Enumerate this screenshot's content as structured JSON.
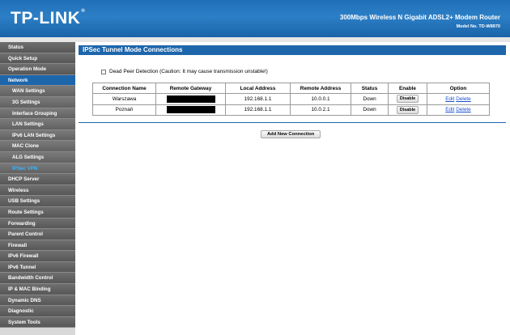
{
  "header": {
    "logo": "TP-LINK",
    "logo_mark": "®",
    "product": "300Mbps Wireless N Gigabit ADSL2+ Modem Router",
    "model": "Model No. TD-W8970"
  },
  "sidebar": {
    "items": [
      {
        "label": "Status",
        "level": 0,
        "state": "normal"
      },
      {
        "label": "Quick Setup",
        "level": 0,
        "state": "normal"
      },
      {
        "label": "Operation Mode",
        "level": 0,
        "state": "normal"
      },
      {
        "label": "Network",
        "level": 0,
        "state": "active"
      },
      {
        "label": "WAN Settings",
        "level": 1,
        "state": "normal"
      },
      {
        "label": "3G Settings",
        "level": 1,
        "state": "normal"
      },
      {
        "label": "Interface Grouping",
        "level": 1,
        "state": "normal"
      },
      {
        "label": "LAN Settings",
        "level": 1,
        "state": "normal"
      },
      {
        "label": "IPv6 LAN Settings",
        "level": 1,
        "state": "normal"
      },
      {
        "label": "MAC Clone",
        "level": 1,
        "state": "normal"
      },
      {
        "label": "ALG Settings",
        "level": 1,
        "state": "normal"
      },
      {
        "label": "IPSec VPN",
        "level": 1,
        "state": "current"
      },
      {
        "label": "DHCP Server",
        "level": 0,
        "state": "normal"
      },
      {
        "label": "Wireless",
        "level": 0,
        "state": "normal"
      },
      {
        "label": "USB Settings",
        "level": 0,
        "state": "normal"
      },
      {
        "label": "Route Settings",
        "level": 0,
        "state": "normal"
      },
      {
        "label": "Forwarding",
        "level": 0,
        "state": "normal"
      },
      {
        "label": "Parent Control",
        "level": 0,
        "state": "normal"
      },
      {
        "label": "Firewall",
        "level": 0,
        "state": "normal"
      },
      {
        "label": "IPv6 Firewall",
        "level": 0,
        "state": "normal"
      },
      {
        "label": "IPv6 Tunnel",
        "level": 0,
        "state": "normal"
      },
      {
        "label": "Bandwidth Control",
        "level": 0,
        "state": "normal"
      },
      {
        "label": "IP & MAC Binding",
        "level": 0,
        "state": "normal"
      },
      {
        "label": "Dynamic DNS",
        "level": 0,
        "state": "normal"
      },
      {
        "label": "Diagnostic",
        "level": 0,
        "state": "normal"
      },
      {
        "label": "System Tools",
        "level": 0,
        "state": "normal"
      }
    ]
  },
  "main": {
    "title": "IPSec Tunnel Mode Connections",
    "dpd_label": "Dead Peer Detection (Caution: It may cause transmission unstable!)",
    "dpd_checked": false,
    "table": {
      "headers": [
        "Connection Name",
        "Remote Gateway",
        "Local Address",
        "Remote Address",
        "Status",
        "Enable",
        "Option"
      ],
      "rows": [
        {
          "name": "Warszawa",
          "local": "192.168.1.1",
          "remote": "10.0.0.1",
          "status": "Down",
          "enable": "Disable",
          "edit": "Edit",
          "delete": "Delete"
        },
        {
          "name": "Poznań",
          "local": "192.168.1.1",
          "remote": "10.0.2.1",
          "status": "Down",
          "enable": "Disable",
          "edit": "Edit",
          "delete": "Delete"
        }
      ]
    },
    "add_button": "Add New Connection"
  },
  "colors": {
    "header_blue": "#2c7fc6",
    "section_blue": "#1d66ac",
    "sidebar_gray": "#626262",
    "current_item": "#3ab4ff",
    "link_blue": "#1a4fd0"
  }
}
